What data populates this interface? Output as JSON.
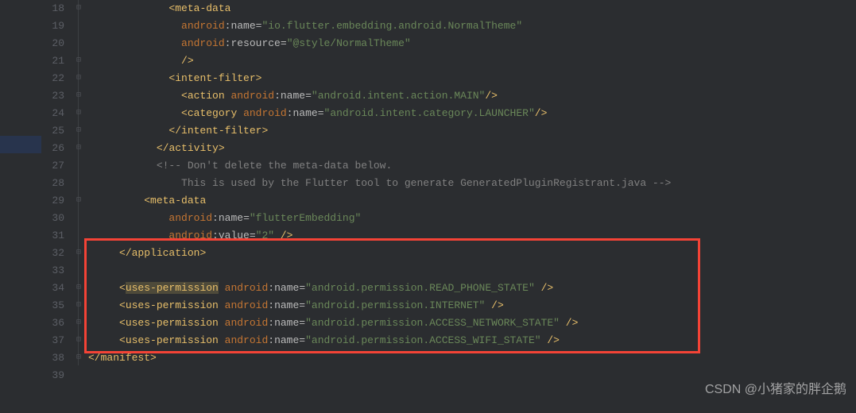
{
  "watermark": "CSDN @小猪家的胖企鹅",
  "lines": [
    {
      "n": 18,
      "fold": "-",
      "ind": 13,
      "tokens": [
        {
          "t": "<",
          "c": "t-punc"
        },
        {
          "t": "meta-data",
          "c": "t-tag"
        }
      ]
    },
    {
      "n": 19,
      "fold": "|",
      "ind": 15,
      "tokens": [
        {
          "t": "android",
          "c": "t-attr-ns"
        },
        {
          "t": ":",
          "c": "t-attr"
        },
        {
          "t": "name",
          "c": "t-attr"
        },
        {
          "t": "=",
          "c": "t-eq"
        },
        {
          "t": "\"io.flutter.embedding.android.NormalTheme\"",
          "c": "t-str"
        }
      ]
    },
    {
      "n": 20,
      "fold": "|",
      "ind": 15,
      "tokens": [
        {
          "t": "android",
          "c": "t-attr-ns"
        },
        {
          "t": ":",
          "c": "t-attr"
        },
        {
          "t": "resource",
          "c": "t-attr"
        },
        {
          "t": "=",
          "c": "t-eq"
        },
        {
          "t": "\"@style/NormalTheme\"",
          "c": "t-str"
        }
      ]
    },
    {
      "n": 21,
      "fold": "-",
      "ind": 15,
      "tokens": [
        {
          "t": "/>",
          "c": "t-punc"
        }
      ]
    },
    {
      "n": 22,
      "fold": "-",
      "ind": 13,
      "tokens": [
        {
          "t": "<",
          "c": "t-punc"
        },
        {
          "t": "intent-filter",
          "c": "t-tag"
        },
        {
          "t": ">",
          "c": "t-punc"
        }
      ]
    },
    {
      "n": 23,
      "fold": "-",
      "ind": 15,
      "tokens": [
        {
          "t": "<",
          "c": "t-punc"
        },
        {
          "t": "action ",
          "c": "t-tag"
        },
        {
          "t": "android",
          "c": "t-attr-ns"
        },
        {
          "t": ":",
          "c": "t-attr"
        },
        {
          "t": "name",
          "c": "t-attr"
        },
        {
          "t": "=",
          "c": "t-eq"
        },
        {
          "t": "\"android.intent.action.MAIN\"",
          "c": "t-str"
        },
        {
          "t": "/>",
          "c": "t-punc"
        }
      ]
    },
    {
      "n": 24,
      "fold": "-",
      "ind": 15,
      "tokens": [
        {
          "t": "<",
          "c": "t-punc"
        },
        {
          "t": "category ",
          "c": "t-tag"
        },
        {
          "t": "android",
          "c": "t-attr-ns"
        },
        {
          "t": ":",
          "c": "t-attr"
        },
        {
          "t": "name",
          "c": "t-attr"
        },
        {
          "t": "=",
          "c": "t-eq"
        },
        {
          "t": "\"android.intent.category.LAUNCHER\"",
          "c": "t-str"
        },
        {
          "t": "/>",
          "c": "t-punc"
        }
      ]
    },
    {
      "n": 25,
      "fold": "-",
      "ind": 13,
      "tokens": [
        {
          "t": "</",
          "c": "t-punc"
        },
        {
          "t": "intent-filter",
          "c": "t-tag"
        },
        {
          "t": ">",
          "c": "t-punc"
        }
      ]
    },
    {
      "n": 26,
      "fold": "-",
      "ind": 11,
      "tokens": [
        {
          "t": "</",
          "c": "t-punc"
        },
        {
          "t": "activity",
          "c": "t-tag"
        },
        {
          "t": ">",
          "c": "t-punc"
        }
      ]
    },
    {
      "n": 27,
      "fold": "|",
      "ind": 11,
      "tokens": [
        {
          "t": "<!-- Don't delete the meta-data below.",
          "c": "t-comment"
        }
      ]
    },
    {
      "n": 28,
      "fold": "|",
      "ind": 14,
      "tokens": [
        {
          "t": " This is used by the Flutter tool to generate GeneratedPluginRegistrant.java -->",
          "c": "t-comment"
        }
      ]
    },
    {
      "n": 29,
      "fold": "-",
      "ind": 9,
      "tokens": [
        {
          "t": "<",
          "c": "t-punc"
        },
        {
          "t": "meta-data",
          "c": "t-tag"
        }
      ]
    },
    {
      "n": 30,
      "fold": "|",
      "ind": 13,
      "tokens": [
        {
          "t": "android",
          "c": "t-attr-ns"
        },
        {
          "t": ":",
          "c": "t-attr"
        },
        {
          "t": "name",
          "c": "t-attr"
        },
        {
          "t": "=",
          "c": "t-eq"
        },
        {
          "t": "\"flutterEmbedding\"",
          "c": "t-str"
        }
      ]
    },
    {
      "n": 31,
      "fold": "|",
      "ind": 13,
      "tokens": [
        {
          "t": "android",
          "c": "t-attr-ns"
        },
        {
          "t": ":",
          "c": "t-attr"
        },
        {
          "t": "value",
          "c": "t-attr"
        },
        {
          "t": "=",
          "c": "t-eq"
        },
        {
          "t": "\"2\"",
          "c": "t-str"
        },
        {
          "t": " />",
          "c": "t-punc"
        }
      ]
    },
    {
      "n": 32,
      "fold": "-",
      "ind": 5,
      "tokens": [
        {
          "t": "</",
          "c": "t-punc"
        },
        {
          "t": "application",
          "c": "t-tag"
        },
        {
          "t": ">",
          "c": "t-punc"
        }
      ]
    },
    {
      "n": 33,
      "fold": "|",
      "ind": 0,
      "tokens": []
    },
    {
      "n": 34,
      "fold": "-",
      "ind": 5,
      "tokens": [
        {
          "t": "<",
          "c": "t-punc"
        },
        {
          "t": "uses-permission",
          "c": "t-tag hl-sel"
        },
        {
          "t": " ",
          "c": ""
        },
        {
          "t": "android",
          "c": "t-attr-ns"
        },
        {
          "t": ":",
          "c": "t-attr"
        },
        {
          "t": "name",
          "c": "t-attr"
        },
        {
          "t": "=",
          "c": "t-eq"
        },
        {
          "t": "\"android.permission.READ_PHONE_STATE\"",
          "c": "t-str"
        },
        {
          "t": " />",
          "c": "t-punc"
        }
      ]
    },
    {
      "n": 35,
      "fold": "-",
      "ind": 5,
      "tokens": [
        {
          "t": "<",
          "c": "t-punc"
        },
        {
          "t": "uses-permission ",
          "c": "t-tag"
        },
        {
          "t": "android",
          "c": "t-attr-ns"
        },
        {
          "t": ":",
          "c": "t-attr"
        },
        {
          "t": "name",
          "c": "t-attr"
        },
        {
          "t": "=",
          "c": "t-eq"
        },
        {
          "t": "\"android.permission.INTERNET\"",
          "c": "t-str"
        },
        {
          "t": " />",
          "c": "t-punc"
        }
      ]
    },
    {
      "n": 36,
      "fold": "-",
      "ind": 5,
      "tokens": [
        {
          "t": "<",
          "c": "t-punc"
        },
        {
          "t": "uses-permission ",
          "c": "t-tag"
        },
        {
          "t": "android",
          "c": "t-attr-ns"
        },
        {
          "t": ":",
          "c": "t-attr"
        },
        {
          "t": "name",
          "c": "t-attr"
        },
        {
          "t": "=",
          "c": "t-eq"
        },
        {
          "t": "\"android.permission.ACCESS_NETWORK_STATE\"",
          "c": "t-str"
        },
        {
          "t": " />",
          "c": "t-punc"
        }
      ]
    },
    {
      "n": 37,
      "fold": "-",
      "ind": 5,
      "tokens": [
        {
          "t": "<",
          "c": "t-punc"
        },
        {
          "t": "uses-permission ",
          "c": "t-tag"
        },
        {
          "t": "android",
          "c": "t-attr-ns"
        },
        {
          "t": ":",
          "c": "t-attr"
        },
        {
          "t": "name",
          "c": "t-attr"
        },
        {
          "t": "=",
          "c": "t-eq"
        },
        {
          "t": "\"android.permission.ACCESS_WIFI_STATE\"",
          "c": "t-str"
        },
        {
          "t": " />",
          "c": "t-punc"
        }
      ]
    },
    {
      "n": 38,
      "fold": "-",
      "ind": 0,
      "tokens": [
        {
          "t": "</",
          "c": "t-punc"
        },
        {
          "t": "manifest",
          "c": "t-tag"
        },
        {
          "t": ">",
          "c": "t-punc"
        }
      ]
    },
    {
      "n": 39,
      "fold": "",
      "ind": 0,
      "tokens": []
    }
  ]
}
